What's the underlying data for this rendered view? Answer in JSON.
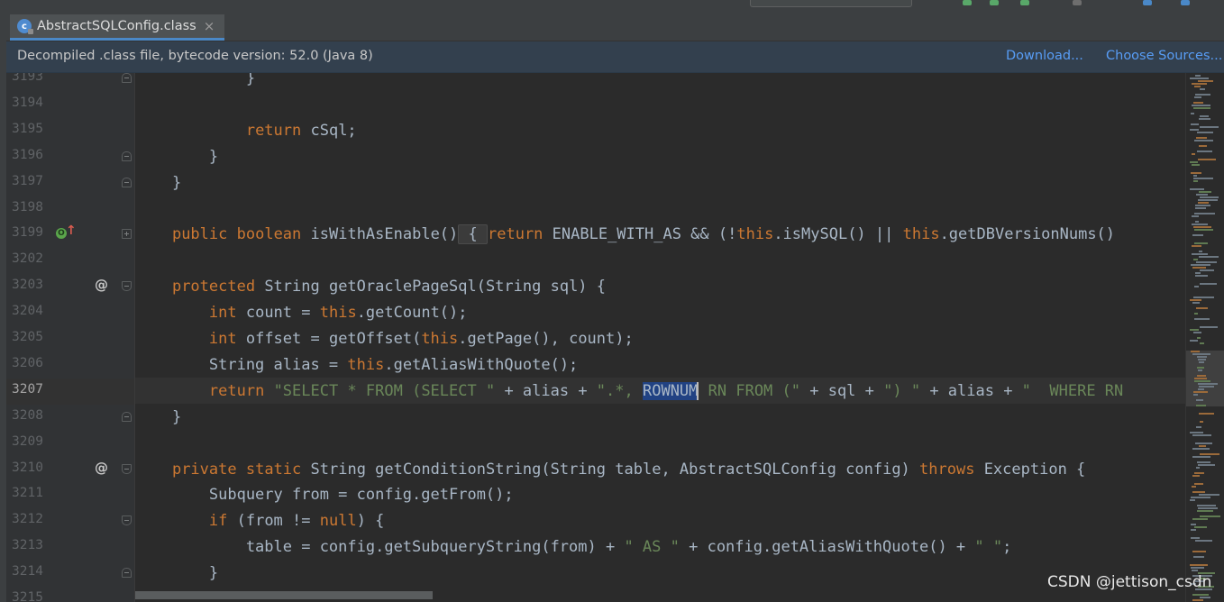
{
  "tab": {
    "icon": "class-file-icon",
    "label": "AbstractSQLConfig.class",
    "close": "×"
  },
  "banner": {
    "text": "Decompiled .class file, bytecode version: 52.0 (Java 8)",
    "download_label": "Download...",
    "choose_sources_label": "Choose Sources..."
  },
  "colors": {
    "keyword": "#cc7832",
    "string": "#6a8759",
    "text": "#a9b7c6",
    "selection": "#214283",
    "banner_bg": "#33404e",
    "link": "#589df6"
  },
  "editor": {
    "current_line": "3207",
    "lines": [
      {
        "num": "3193",
        "segments": [
          {
            "t": "            }"
          }
        ]
      },
      {
        "num": "3194",
        "segments": []
      },
      {
        "num": "3195",
        "segments": [
          {
            "t": "            "
          },
          {
            "t": "return",
            "c": "kw"
          },
          {
            "t": " cSql;"
          }
        ]
      },
      {
        "num": "3196",
        "segments": [
          {
            "t": "        }"
          }
        ]
      },
      {
        "num": "3197",
        "segments": [
          {
            "t": "    }"
          }
        ]
      },
      {
        "num": "3198",
        "segments": []
      },
      {
        "num": "3199",
        "segments": [
          {
            "t": "    "
          },
          {
            "t": "public",
            "c": "kw"
          },
          {
            "t": " "
          },
          {
            "t": "boolean",
            "c": "kw"
          },
          {
            "t": " isWithAsEnable()"
          },
          {
            "t": " { ",
            "c": "ib"
          },
          {
            "t": "return",
            "c": "kw"
          },
          {
            "t": " ENABLE_WITH_AS && (!"
          },
          {
            "t": "this",
            "c": "kw"
          },
          {
            "t": ".isMySQL() || "
          },
          {
            "t": "this",
            "c": "kw"
          },
          {
            "t": ".getDBVersionNums()"
          }
        ]
      },
      {
        "num": "3202",
        "segments": []
      },
      {
        "num": "3203",
        "segments": [
          {
            "t": "    "
          },
          {
            "t": "protected",
            "c": "kw"
          },
          {
            "t": " String getOraclePageSql(String sql) {"
          }
        ]
      },
      {
        "num": "3204",
        "segments": [
          {
            "t": "        "
          },
          {
            "t": "int",
            "c": "kw"
          },
          {
            "t": " count = "
          },
          {
            "t": "this",
            "c": "kw"
          },
          {
            "t": ".getCount();"
          }
        ]
      },
      {
        "num": "3205",
        "segments": [
          {
            "t": "        "
          },
          {
            "t": "int",
            "c": "kw"
          },
          {
            "t": " offset = getOffset("
          },
          {
            "t": "this",
            "c": "kw"
          },
          {
            "t": ".getPage(), count);"
          }
        ]
      },
      {
        "num": "3206",
        "segments": [
          {
            "t": "        String alias = "
          },
          {
            "t": "this",
            "c": "kw"
          },
          {
            "t": ".getAliasWithQuote();"
          }
        ]
      },
      {
        "num": "3207",
        "segments": [
          {
            "t": "        "
          },
          {
            "t": "return",
            "c": "kw"
          },
          {
            "t": " "
          },
          {
            "t": "\"SELECT * FROM (SELECT \"",
            "c": "str"
          },
          {
            "t": " + alias + "
          },
          {
            "t": "\".*, ",
            "c": "str"
          },
          {
            "t": "ROWNUM",
            "c": "hl"
          },
          {
            "t": "|",
            "c": "caret"
          },
          {
            "t": " RN FROM (\"",
            "c": "str"
          },
          {
            "t": " + sql + "
          },
          {
            "t": "\") \"",
            "c": "str"
          },
          {
            "t": " + alias + "
          },
          {
            "t": "\"  WHERE RN",
            "c": "str"
          }
        ]
      },
      {
        "num": "3208",
        "segments": [
          {
            "t": "    }"
          }
        ]
      },
      {
        "num": "3209",
        "segments": []
      },
      {
        "num": "3210",
        "segments": [
          {
            "t": "    "
          },
          {
            "t": "private",
            "c": "kw"
          },
          {
            "t": " "
          },
          {
            "t": "static",
            "c": "kw"
          },
          {
            "t": " String getConditionString(String table, AbstractSQLConfig config) "
          },
          {
            "t": "throws",
            "c": "kw"
          },
          {
            "t": " Exception {"
          }
        ]
      },
      {
        "num": "3211",
        "segments": [
          {
            "t": "        Subquery from = config.getFrom();"
          }
        ]
      },
      {
        "num": "3212",
        "segments": [
          {
            "t": "        "
          },
          {
            "t": "if",
            "c": "kw"
          },
          {
            "t": " (from != "
          },
          {
            "t": "null",
            "c": "kw"
          },
          {
            "t": ") {"
          }
        ]
      },
      {
        "num": "3213",
        "segments": [
          {
            "t": "            table = config.getSubqueryString(from) + "
          },
          {
            "t": "\" AS \"",
            "c": "str"
          },
          {
            "t": " + config.getAliasWithQuote() + "
          },
          {
            "t": "\" \"",
            "c": "str"
          },
          {
            "t": ";"
          }
        ]
      },
      {
        "num": "3214",
        "segments": [
          {
            "t": "        }"
          }
        ]
      },
      {
        "num": "3215",
        "segments": []
      }
    ]
  },
  "gutter_marks": {
    "3193": "fold-end",
    "3196": "fold-end",
    "3197": "fold-end",
    "3199": "fold-plus",
    "3203": "fold-start",
    "3208": "fold-end",
    "3210": "fold-start",
    "3212": "fold-start",
    "3214": "fold-end",
    "override_line": "3199",
    "override_icon": "overrides-method-icon",
    "at_lines": [
      "3203",
      "3210"
    ],
    "at_symbol": "@"
  },
  "watermark": "CSDN @jettison_csdn"
}
